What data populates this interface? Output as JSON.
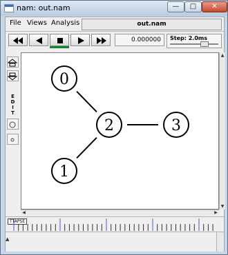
{
  "window": {
    "title": "nam: out.nam",
    "minimize_symbol": "—",
    "maximize_symbol": "□",
    "close_symbol": "✕"
  },
  "menu": {
    "file": "File",
    "views": "Views",
    "analysis": "Analysis",
    "trace_title": "out.nam"
  },
  "toolbar": {
    "buttons": [
      "rewind-icon",
      "back-icon",
      "stop-icon",
      "play-icon",
      "fast-forward-icon"
    ],
    "time": "0.000000",
    "step": "Step: 2.0ms"
  },
  "tools": {
    "edit_letters": [
      "E",
      "D",
      "I",
      "T"
    ]
  },
  "topology": {
    "nodes": [
      {
        "id": "0"
      },
      {
        "id": "1"
      },
      {
        "id": "2"
      },
      {
        "id": "3"
      }
    ],
    "links": [
      [
        "0",
        "2"
      ],
      [
        "1",
        "2"
      ],
      [
        "2",
        "3"
      ]
    ]
  },
  "timeline": {
    "icon_label": "TTAPSE"
  },
  "colors": {
    "timeline_marker": "#4a5adf",
    "play_indicator": "#0e8a2f",
    "close_button": "#c44a2e"
  }
}
